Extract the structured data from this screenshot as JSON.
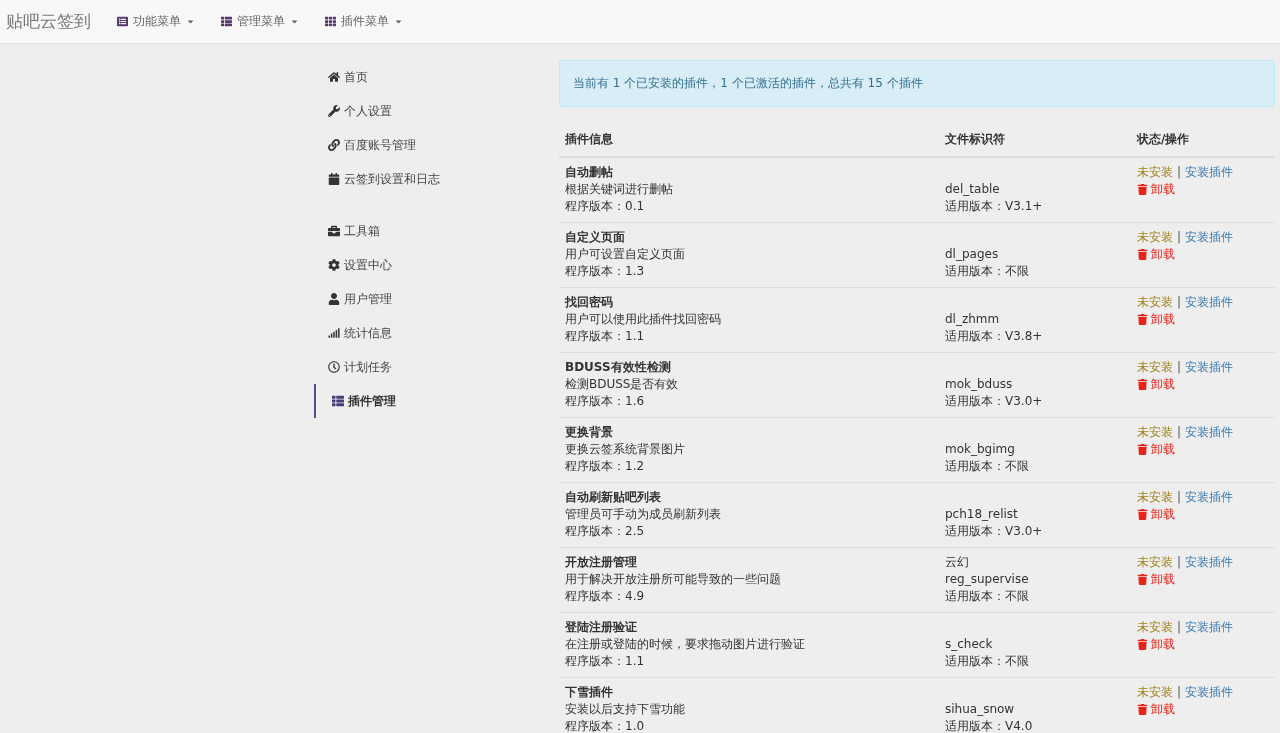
{
  "navbar": {
    "brand": "贴吧云签到",
    "menus": [
      {
        "label": "功能菜单"
      },
      {
        "label": "管理菜单"
      },
      {
        "label": "插件菜单"
      }
    ]
  },
  "sidebar": {
    "groups": [
      {
        "items": [
          {
            "label": "首页",
            "selected": false
          },
          {
            "label": "个人设置",
            "selected": false
          },
          {
            "label": "百度账号管理",
            "selected": false
          },
          {
            "label": "云签到设置和日志",
            "selected": false
          }
        ]
      },
      {
        "items": [
          {
            "label": "工具箱",
            "selected": false
          },
          {
            "label": "设置中心",
            "selected": false
          },
          {
            "label": "用户管理",
            "selected": false
          },
          {
            "label": "统计信息",
            "selected": false
          },
          {
            "label": "计划任务",
            "selected": false
          },
          {
            "label": "插件管理",
            "selected": true
          }
        ]
      }
    ]
  },
  "alert": "当前有 1 个已安装的插件，1 个已激活的插件，总共有 15 个插件",
  "table": {
    "columns": [
      "插件信息",
      "文件标识符",
      "状态/操作"
    ],
    "rows": [
      {
        "name": "自动删帖",
        "description": "根据关键词进行删帖",
        "version": "程序版本：0.1",
        "file_id": "del_table",
        "compat": "适用版本：V3.1+",
        "status": "未安装",
        "separator": "|",
        "action": "安装插件",
        "uninstall": "卸载"
      },
      {
        "name": "自定义页面",
        "description": "用户可设置自定义页面",
        "version": "程序版本：1.3",
        "file_id": "dl_pages",
        "compat": "适用版本：不限",
        "status": "未安装",
        "separator": "|",
        "action": "安装插件",
        "uninstall": "卸载"
      },
      {
        "name": "找回密码",
        "description": "用户可以使用此插件找回密码",
        "version": "程序版本：1.1",
        "file_id": "dl_zhmm",
        "compat": "适用版本：V3.8+",
        "status": "未安装",
        "separator": "|",
        "action": "安装插件",
        "uninstall": "卸载"
      },
      {
        "name": "BDUSS有效性检测",
        "description": "检测BDUSS是否有效",
        "version": "程序版本：1.6",
        "file_id": "mok_bduss",
        "compat": "适用版本：V3.0+",
        "status": "未安装",
        "separator": "|",
        "action": "安装插件",
        "uninstall": "卸载"
      },
      {
        "name": "更换背景",
        "description": "更换云签系统背景图片",
        "version": "程序版本：1.2",
        "file_id": "mok_bgimg",
        "compat": "适用版本：不限",
        "status": "未安装",
        "separator": "|",
        "action": "安装插件",
        "uninstall": "卸载"
      },
      {
        "name": "自动刷新贴吧列表",
        "description": "管理员可手动为成员刷新列表",
        "version": "程序版本：2.5",
        "file_id": "pch18_relist",
        "compat": "适用版本：V3.0+",
        "status": "未安装",
        "separator": "|",
        "action": "安装插件",
        "uninstall": "卸载"
      },
      {
        "name": "开放注册管理",
        "description": "用于解决开放注册所可能导致的一些问题",
        "version": "程序版本：4.9",
        "author": "云幻",
        "file_id": "reg_supervise",
        "compat": "适用版本：不限",
        "status": "未安装",
        "separator": "|",
        "action": "安装插件",
        "uninstall": "卸载"
      },
      {
        "name": "登陆注册验证",
        "description": "在注册或登陆的时候，要求拖动图片进行验证",
        "version": "程序版本：1.1",
        "file_id": "s_check",
        "compat": "适用版本：不限",
        "status": "未安装",
        "separator": "|",
        "action": "安装插件",
        "uninstall": "卸载"
      },
      {
        "name": "下雪插件",
        "description": "安装以后支持下雪功能",
        "version": "程序版本：1.0",
        "file_id": "sihua_snow",
        "compat": "适用版本：V4.0",
        "status": "未安装",
        "separator": "|",
        "action": "安装插件",
        "uninstall": "卸载"
      }
    ]
  }
}
